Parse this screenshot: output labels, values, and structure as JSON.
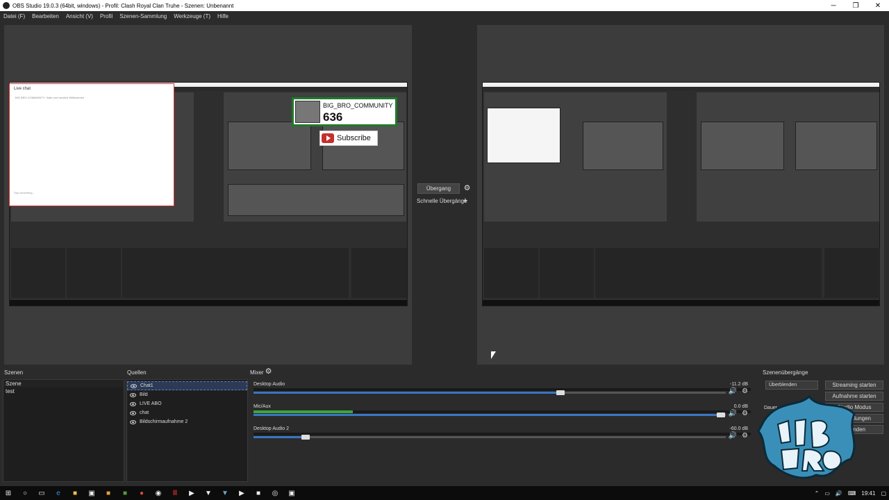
{
  "window": {
    "title": "OBS Studio 19.0.3 (64bit, windows) - Profil: Clash Royal Clan Truhe - Szenen: Unbenannt",
    "controls": [
      "─",
      "❐",
      "✕"
    ]
  },
  "menu": [
    "Datei (F)",
    "Bearbeiten",
    "Ansicht (V)",
    "Profil",
    "Szenen-Sammlung",
    "Werkzeuge (T)",
    "Hilfe"
  ],
  "preview": {
    "chat_title": "Live chat",
    "chat_message": "BIG BRO COMMUNITY: Hallo und herzlich Willkommen",
    "chat_input": "Say something...",
    "sub_name": "BIG_BRO_COMMUNITY",
    "sub_count": "636",
    "subscribe_label": "Subscribe"
  },
  "transition": {
    "button_label": "Übergang",
    "quick_label": "Schnelle Übergänge"
  },
  "scenes": {
    "header": "Szenen",
    "items": [
      "Szene",
      "test"
    ]
  },
  "sources": {
    "header": "Quellen",
    "items": [
      "Chat1",
      "Bild",
      "LIVE ABO",
      "chat",
      "Bildschirmaufnahme 2"
    ]
  },
  "mixer": {
    "header": "Mixer",
    "channels": [
      {
        "name": "Desktop Audio",
        "db": "-11.2 dB",
        "level": 0.0,
        "volume": 0.65
      },
      {
        "name": "Mic/Aux",
        "db": "0.0 dB",
        "level": 0.2,
        "volume": 0.99
      },
      {
        "name": "Desktop Audio 2",
        "db": "-60.0 dB",
        "level": 0.0,
        "volume": 0.11
      }
    ]
  },
  "scene_transitions": {
    "header": "Szenenübergänge",
    "selected": "Überblenden",
    "duration_label": "Dauer"
  },
  "controls": {
    "start_streaming": "Streaming starten",
    "start_recording": "Aufnahme starten",
    "studio_mode": "Studio Modus",
    "settings": "Einstellungen",
    "exit": "Beenden"
  },
  "taskbar": {
    "clock": "19:41"
  },
  "colors": {
    "background": "#2b2b2b",
    "slider": "#3a75c4",
    "meter": "#3ca63c",
    "chat_border": "#dd3333",
    "subscriber_border": "#1e7a2a"
  }
}
